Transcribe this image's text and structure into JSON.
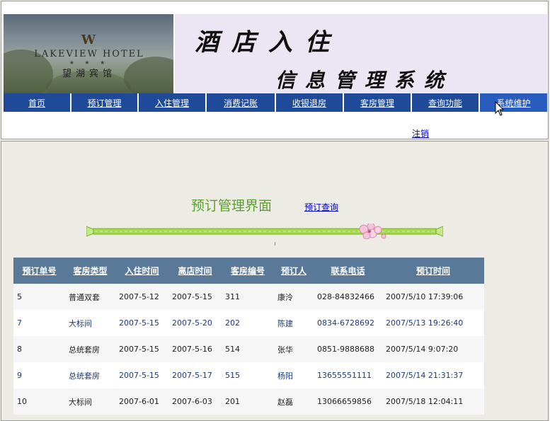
{
  "banner": {
    "logo_text": "LAKEVIEW HOTEL",
    "logo_stars": "★ ★ ★",
    "logo_cn": "望湖宾馆",
    "title_line1": "酒店入住",
    "title_line2": "信息管理系统"
  },
  "nav": {
    "items": [
      {
        "label": "首页"
      },
      {
        "label": "预订管理"
      },
      {
        "label": "入住管理"
      },
      {
        "label": "消费记账"
      },
      {
        "label": "收银退房"
      },
      {
        "label": "客房管理"
      },
      {
        "label": "查询功能"
      },
      {
        "label": "系统维护"
      }
    ],
    "logout": "注销"
  },
  "main": {
    "title": "预订管理界面",
    "query_link": "预订查询"
  },
  "table": {
    "headers": [
      "预订单号",
      "客房类型",
      "入住时间",
      "离店时间",
      "客房编号",
      "预订人",
      "联系电话",
      "预订时间"
    ],
    "rows": [
      [
        "5",
        "普通双套",
        "2007-5-12",
        "2007-5-15",
        "311",
        "康泠",
        "028-84832466",
        "2007/5/10 17:39:06"
      ],
      [
        "7",
        "大标间",
        "2007-5-15",
        "2007-5-20",
        "202",
        "陈建",
        "0834-6728692",
        "2007/5/13 19:26:40"
      ],
      [
        "8",
        "总统套房",
        "2007-5-15",
        "2007-5-16",
        "514",
        "张华",
        "0851-9888688",
        "2007/5/14 9:07:20"
      ],
      [
        "9",
        "总统套房",
        "2007-5-15",
        "2007-5-17",
        "515",
        "杨阳",
        "13655551111",
        "2007/5/14 21:31:37"
      ],
      [
        "10",
        "大标间",
        "2007-6-01",
        "2007-6-03",
        "201",
        "赵磊",
        "13066659856",
        "2007/5/18 12:04:11"
      ]
    ]
  },
  "colors": {
    "nav_bg": "#1f4a9a",
    "table_header_bg": "#5a7898",
    "title_green": "#5aa22c"
  }
}
